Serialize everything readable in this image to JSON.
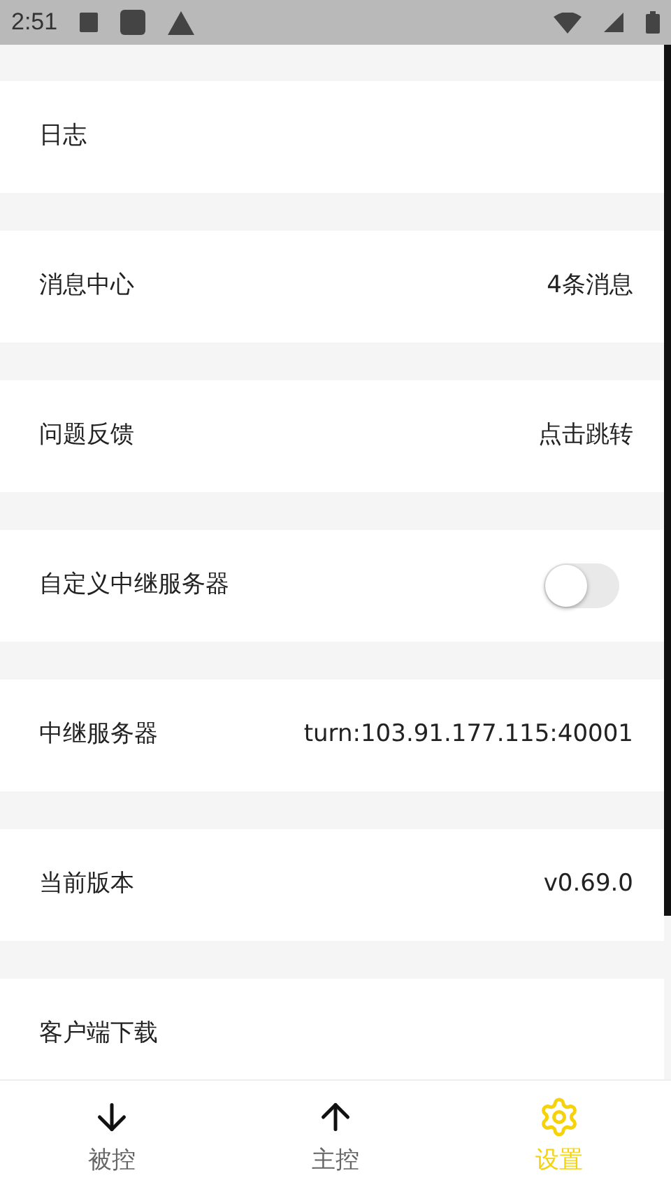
{
  "status_bar": {
    "time": "2:51"
  },
  "settings": [
    {
      "kind": "plain",
      "label": "日志"
    },
    {
      "kind": "value",
      "label": "消息中心",
      "value": "4条消息"
    },
    {
      "kind": "value",
      "label": "问题反馈",
      "value": "点击跳转"
    },
    {
      "kind": "toggle",
      "label": "自定义中继服务器",
      "on": false
    },
    {
      "kind": "value",
      "label": "中继服务器",
      "value": "turn:103.91.177.115:40001"
    },
    {
      "kind": "value",
      "label": "当前版本",
      "value": "v0.69.0"
    },
    {
      "kind": "plain",
      "label": "客户端下载"
    }
  ],
  "bottom_nav": [
    {
      "label": "被控",
      "selected": false
    },
    {
      "label": "主控",
      "selected": false
    },
    {
      "label": "设置",
      "selected": true
    }
  ]
}
